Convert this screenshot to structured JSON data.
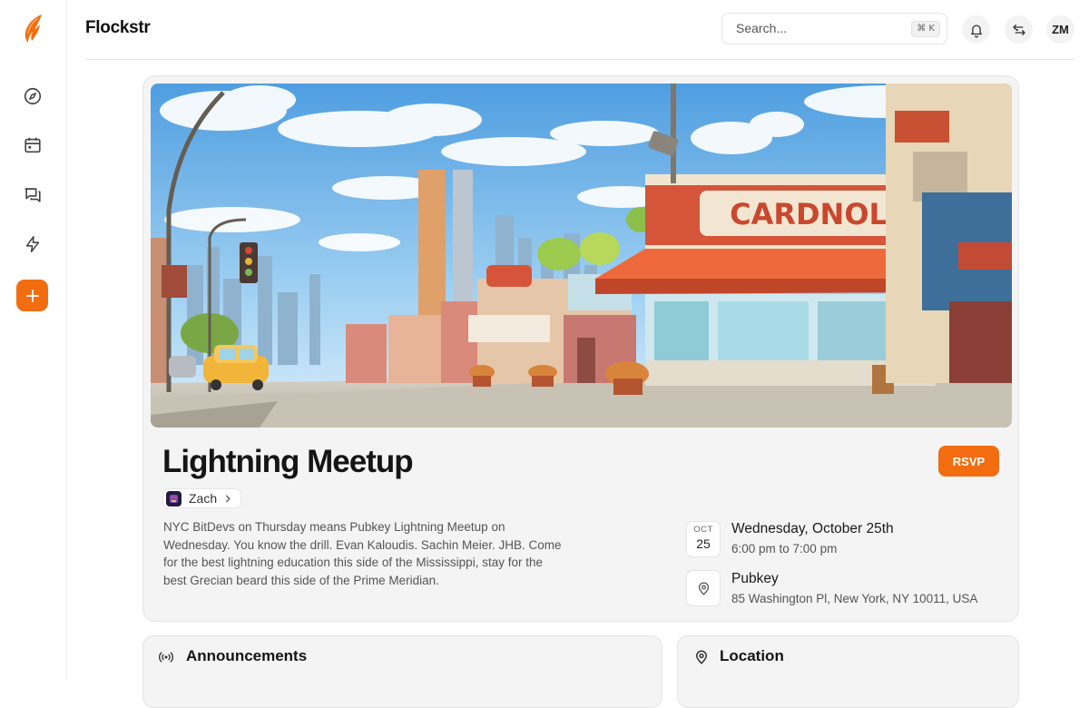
{
  "app": {
    "name": "Flockstr",
    "brand_color": "#f26d0f"
  },
  "sidebar": {
    "items": [
      {
        "name": "explore",
        "icon": "compass-icon"
      },
      {
        "name": "calendar",
        "icon": "calendar-icon"
      },
      {
        "name": "messages",
        "icon": "messages-icon"
      },
      {
        "name": "zaps",
        "icon": "lightning-icon"
      }
    ],
    "add_icon": "plus-icon"
  },
  "header": {
    "search_placeholder": "Search...",
    "search_shortcut": "⌘ K",
    "user_initials": "ZM"
  },
  "event": {
    "title": "Lightning Meetup",
    "rsvp_label": "RSVP",
    "host": "Zach",
    "description": "NYC BitDevs on Thursday means Pubkey Lightning Meetup on Wednesday. You know the drill. Evan Kaloudis. Sachin Meier. JHB. Come for the best lightning education this side of the Mississippi, stay for the best Grecian beard this side of the Prime Meridian.",
    "date": {
      "month": "OCT",
      "day": "25",
      "full": "Wednesday, October 25th",
      "time": "6:00 pm to 7:00 pm"
    },
    "venue": {
      "name": "Pubkey",
      "address": "85 Washington Pl, New York, NY 10011, USA"
    },
    "sign_text": "CARDNOL"
  },
  "panels": {
    "announcements": "Announcements",
    "location": "Location"
  }
}
